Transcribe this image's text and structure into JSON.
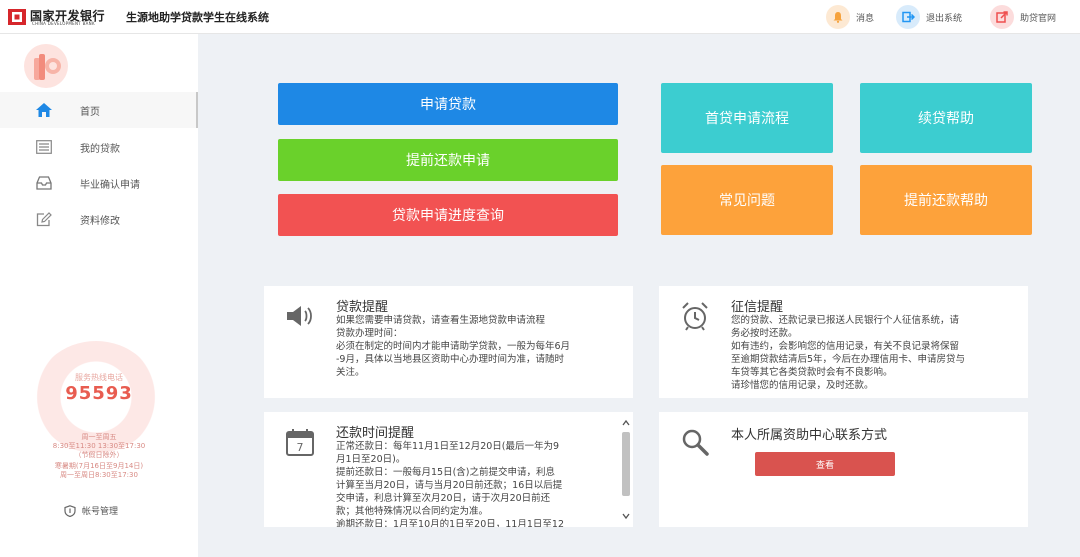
{
  "header": {
    "brand_cn": "国家开发银行",
    "brand_en": "CHINA DEVELOPMENT BANK",
    "system_title": "生源地助学贷款学生在线系统",
    "actions": [
      {
        "label": "消息",
        "icon": "bell-icon",
        "color": "#f6a23c"
      },
      {
        "label": "退出系统",
        "icon": "logout-icon",
        "color": "#2196f3"
      },
      {
        "label": "助贷官网",
        "icon": "external-link-icon",
        "color": "#ef4f4f"
      }
    ]
  },
  "sidebar": {
    "items": [
      {
        "label": "首页",
        "icon": "home-icon"
      },
      {
        "label": "我的贷款",
        "icon": "list-icon"
      },
      {
        "label": "毕业确认申请",
        "icon": "inbox-icon"
      },
      {
        "label": "资料修改",
        "icon": "edit-icon"
      }
    ],
    "hotline": {
      "label": "服务热线电话",
      "number": "95593",
      "lines": [
        "周一至周五",
        "8:30至11:30 13:30至17:30",
        "（节假日除外）",
        "寒暑期(7月16日至9月14日)",
        "周一至周日8:30至17:30"
      ]
    },
    "account_label": "帐号管理"
  },
  "main": {
    "left_buttons": [
      {
        "label": "申请贷款",
        "color": "#1e88e5"
      },
      {
        "label": "提前还款申请",
        "color": "#6ad12b"
      },
      {
        "label": "贷款申请进度查询",
        "color": "#f25252"
      }
    ],
    "right_buttons": [
      {
        "label": "首贷申请流程",
        "color": "#3ccdd0"
      },
      {
        "label": "续贷帮助",
        "color": "#3ccdd0"
      },
      {
        "label": "常见问题",
        "color": "#fda23b"
      },
      {
        "label": "提前还款帮助",
        "color": "#fda23b"
      }
    ],
    "cards": {
      "loan_reminder": {
        "title": "贷款提醒",
        "icon": "speaker-icon",
        "lines": [
          "如果您需要申请贷款，请查看生源地贷款申请流程",
          "贷款办理时间：",
          "必须在制定的时间内才能申请助学贷款，一般为每年6月",
          "-9月，具体以当地县区资助中心办理时间为准，请随时",
          "关注。"
        ]
      },
      "credit_reminder": {
        "title": "征信提醒",
        "icon": "alarm-clock-icon",
        "lines": [
          "您的贷款、还款记录已报送人民银行个人征信系统，请",
          "务必按时还款。",
          "如有违约，会影响您的信用记录，有关不良记录将保留",
          "至逾期贷款结清后5年，今后在办理信用卡、申请房贷与",
          "车贷等其它各类贷款时会有不良影响。",
          "请珍惜您的信用记录，及时还款。"
        ]
      },
      "repayment_reminder": {
        "title": "还款时间提醒",
        "icon": "calendar-icon",
        "lines": [
          "正常还款日：每年11月1日至12月20日(最后一年为9",
          "月1日至20日)。",
          "提前还款日：一般每月15日(含)之前提交申请，利息",
          "计算至当月20日，请与当月20日前还款；16日以后提",
          "交申请，利息计算至次月20日，请于次月20日前还",
          "款；其他特殊情况以合同约定为准。",
          "逾期还款日：1月至10月的1日至20日，11月1日至12"
        ]
      },
      "contact": {
        "title": "本人所属资助中心联系方式",
        "icon": "search-icon",
        "button_label": "查看"
      }
    }
  }
}
